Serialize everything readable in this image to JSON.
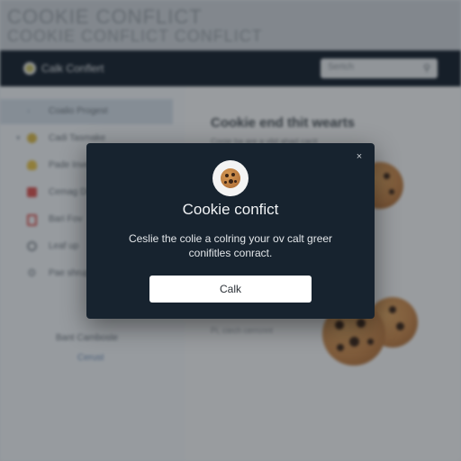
{
  "banner": {
    "line1": "COOKIE CONFLICT",
    "line2": "COOKIE CONFLICT CONFLICT"
  },
  "navbar": {
    "title": "Calk Conflert",
    "search_placeholder": "Sertch",
    "search_icon": "search-icon"
  },
  "sidebar": {
    "items": [
      {
        "label": "Coalio Progest",
        "icon": "chevron-icon",
        "color": "#9aa7b4"
      },
      {
        "label": "Cadi Tasmake",
        "icon": "badge-icon",
        "color": "#d9b94a"
      },
      {
        "label": "Pade Invers",
        "icon": "bulb-icon",
        "color": "#e7c34b"
      },
      {
        "label": "Cemag Di",
        "icon": "square-icon",
        "color": "#d9534f"
      },
      {
        "label": "Bari Fov",
        "icon": "page-icon",
        "color": "#d9534f"
      },
      {
        "label": "Leaf up",
        "icon": "circle-icon",
        "color": "#8a9097"
      },
      {
        "label": "Pae shrup",
        "icon": "gear-icon",
        "color": "#8a9097"
      }
    ],
    "footer_label": "Bant Camboste",
    "footer_link": "Cerust"
  },
  "main": {
    "heading": "Cookie end thit wearts",
    "subtext": "Cooie ba are a vlid ahad cacit",
    "faint_text": "Pi, ciech cerrcnnt"
  },
  "modal": {
    "title": "Cookie confict",
    "body": "Ceslie the colie a colring your ov calt greer conifitles conract.",
    "button_label": "Calk",
    "close_glyph": "×",
    "icon": "cookie-icon"
  },
  "colors": {
    "navbar": "#16202c",
    "modal": "#17232f",
    "button": "#ffffff"
  }
}
